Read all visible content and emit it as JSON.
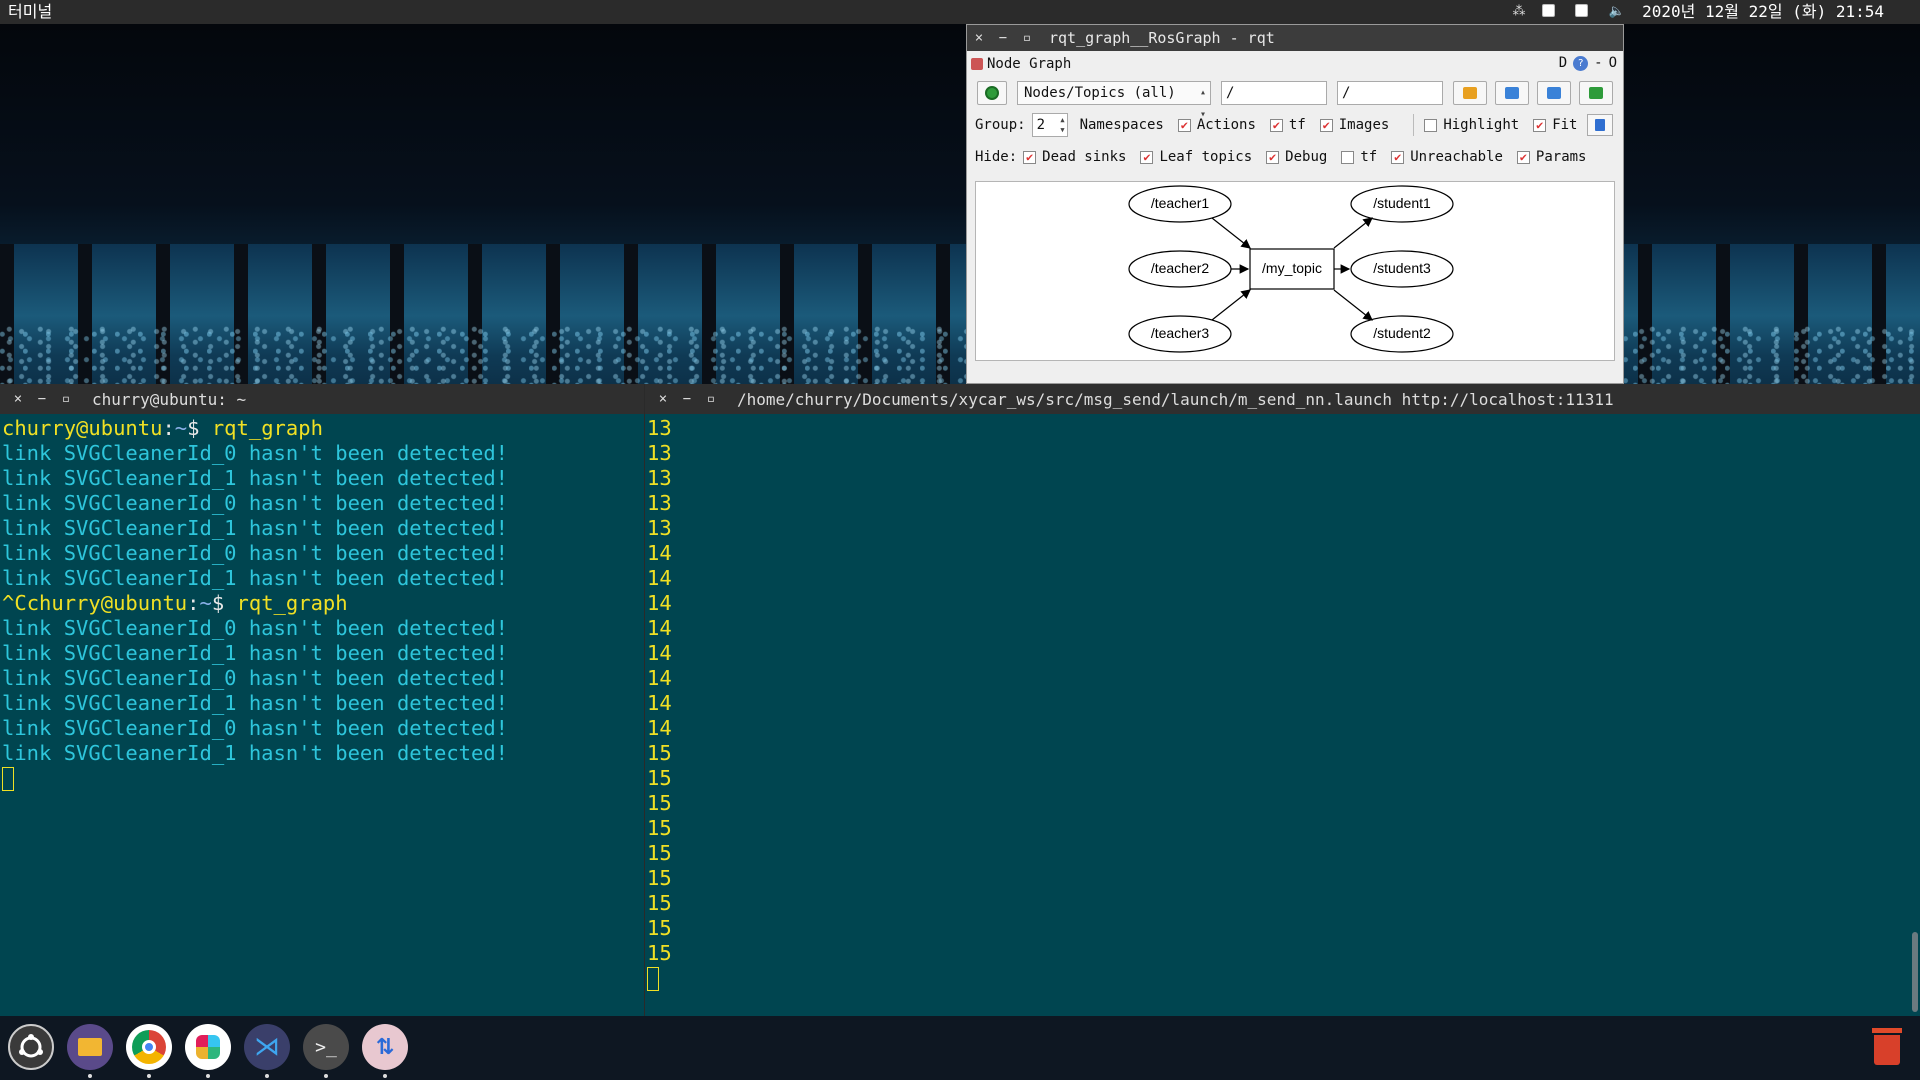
{
  "topbar": {
    "app_name": "터미널",
    "clock": "2020년 12월 22일 (화) 21:54",
    "tray_icons": [
      "network-icon",
      "keyboard-icon",
      "window-icon",
      "volume-icon"
    ]
  },
  "rqt": {
    "window_title": "rqt_graph__RosGraph - rqt",
    "panel_title": "Node Graph",
    "panel_right": "D",
    "panel_dash": "-",
    "panel_o": "O",
    "view_mode": "Nodes/Topics (all)",
    "filter_ns": "/",
    "filter_topic": "/",
    "group_label": "Group:",
    "group_value": "2",
    "namespaces_label": "Namespaces",
    "options": {
      "actions": {
        "label": "Actions",
        "checked": true
      },
      "tf": {
        "label": "tf",
        "checked": true
      },
      "images": {
        "label": "Images",
        "checked": true
      },
      "highlight": {
        "label": "Highlight",
        "checked": false
      },
      "fit": {
        "label": "Fit",
        "checked": true
      }
    },
    "hide_label": "Hide:",
    "hide": {
      "dead_sinks": {
        "label": "Dead sinks",
        "checked": true
      },
      "leaf_topics": {
        "label": "Leaf topics",
        "checked": true
      },
      "debug": {
        "label": "Debug",
        "checked": true
      },
      "tf": {
        "label": "tf",
        "checked": false
      },
      "unreachable": {
        "label": "Unreachable",
        "checked": true
      },
      "params": {
        "label": "Params",
        "checked": true
      }
    },
    "graph": {
      "nodes": [
        "/teacher1",
        "/teacher2",
        "/teacher3",
        "/student1",
        "/student3",
        "/student2"
      ],
      "topic": "/my_topic"
    }
  },
  "term_left": {
    "title": "churry@ubuntu: ~",
    "user": "churry@ubuntu",
    "sep": ":",
    "path": "~",
    "dollar": "$ ",
    "cmd": "rqt_graph",
    "interrupt": "^C",
    "warn0": "link SVGCleanerId_0 hasn't been detected!",
    "warn1": "link SVGCleanerId_1 hasn't been detected!"
  },
  "term_right": {
    "title": "/home/churry/Documents/xycar_ws/src/msg_send/launch/m_send_nn.launch http://localhost:11311",
    "lines": [
      "13",
      "13",
      "13",
      "13",
      "13",
      "14",
      "14",
      "14",
      "14",
      "14",
      "14",
      "14",
      "14",
      "15",
      "15",
      "15",
      "15",
      "15",
      "15",
      "15",
      "15",
      "15"
    ]
  },
  "dock": {
    "apps": [
      "ubuntu-icon",
      "files-icon",
      "chrome-icon",
      "slack-icon",
      "vscode-icon",
      "terminal-icon",
      "updater-icon"
    ],
    "trash": "trash-icon"
  },
  "colors": {
    "terminal_bg": "#004550",
    "prompt_yellow": "#f0e024",
    "output_cyan": "#2ec6dc"
  }
}
